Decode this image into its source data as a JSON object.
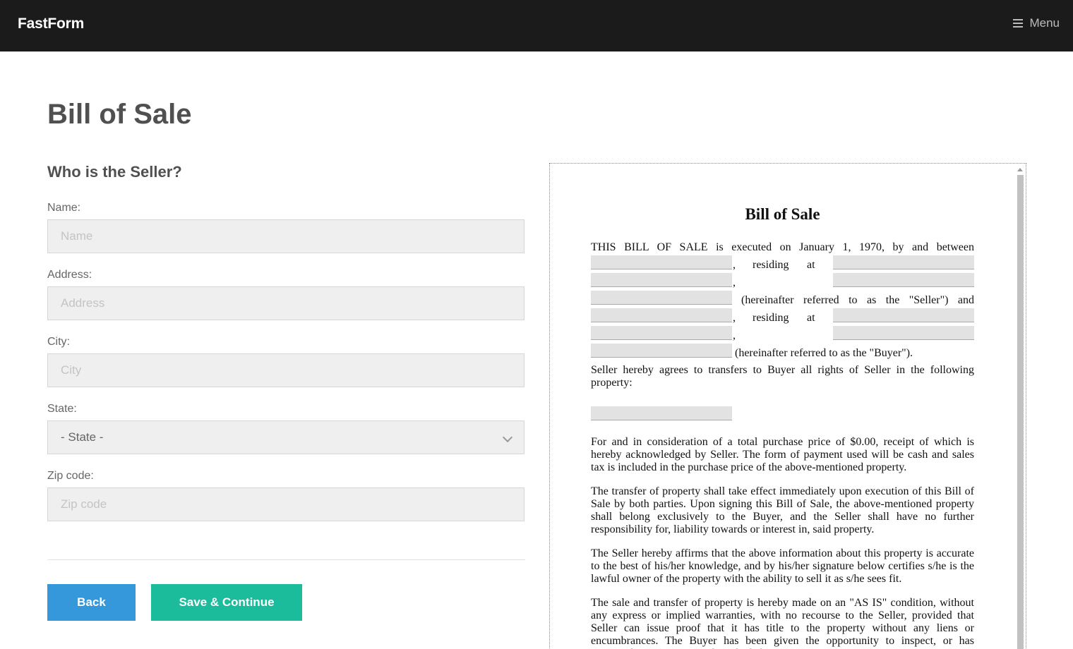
{
  "navbar": {
    "brand": "FastForm",
    "menu_label": "Menu"
  },
  "page": {
    "title": "Bill of Sale",
    "section_title": "Who is the Seller?"
  },
  "form": {
    "name": {
      "label": "Name:",
      "placeholder": "Name",
      "value": ""
    },
    "address": {
      "label": "Address:",
      "placeholder": "Address",
      "value": ""
    },
    "city": {
      "label": "City:",
      "placeholder": "City",
      "value": ""
    },
    "state": {
      "label": "State:",
      "selected": "- State -"
    },
    "zip": {
      "label": "Zip code:",
      "placeholder": "Zip code",
      "value": ""
    }
  },
  "buttons": {
    "back": "Back",
    "save_continue": "Save & Continue"
  },
  "document": {
    "title": "Bill of Sale",
    "intro": {
      "line1": "THIS BILL OF SALE is executed on January 1, 1970, by and between",
      "comma": ",",
      "residing": "residing",
      "at": "at",
      "seller_phrase": "(hereinafter referred to as the \"Seller\") and",
      "buyer_phrase": "(hereinafter referred to as the \"Buyer\")."
    },
    "property_intro": "Seller hereby agrees to transfers to Buyer all rights of Seller in the following property:",
    "paragraphs": [
      "For and in consideration of a total purchase price of $0.00, receipt of which is hereby acknowledged by Seller. The form of payment used will be cash and sales tax is included in the purchase price of the above-mentioned property.",
      "The transfer of property shall take effect immediately upon execution of this Bill of Sale by both parties. Upon signing this Bill of Sale, the above-mentioned property shall belong exclusively to the Buyer, and the Seller shall have no further responsibility for, liability towards or interest in, said property.",
      "The Seller hereby affirms that the above information about this property is accurate to the best of his/her knowledge, and by his/her signature below certifies s/he is the lawful owner of the property with the ability to sell it as s/he sees fit.",
      "The sale and transfer of property is hereby made on an \"AS IS\" condition, without any express or implied warranties, with no recourse to the Seller, provided that Seller can issue proof that it has title to the property without any liens or encumbrances. The Buyer has been given the opportunity to inspect, or has inspected, the property as described above. The Buyer agrees to accept all property"
    ]
  },
  "icons": {
    "menu": "hamburger-icon",
    "select": "chevron-down-icon",
    "scroll": "scroll-up-arrow-icon"
  },
  "colors": {
    "navbar_bg": "#1b1b1b",
    "back_button": "#3498db",
    "save_button": "#1abc9c",
    "input_bg": "#efefef"
  }
}
